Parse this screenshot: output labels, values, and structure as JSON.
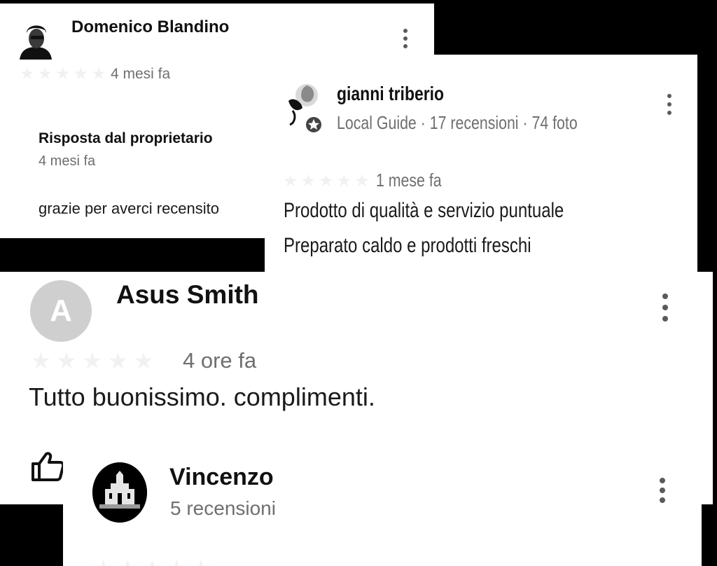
{
  "reviews": [
    {
      "name": "Domenico Blandino",
      "time": "4 mesi fa",
      "owner_reply": {
        "heading": "Risposta dal proprietario",
        "time": "4 mesi fa",
        "text": "grazie per averci recensito"
      }
    },
    {
      "name": "gianni triberio",
      "meta": "Local Guide · 17 recensioni · 74 foto",
      "time": "1 mese fa",
      "text_lines": [
        "Prodotto di qualità e servizio puntuale",
        "Preparato caldo e prodotti freschi"
      ]
    },
    {
      "name": "Asus Smith",
      "avatar_letter": "A",
      "time": "4 ore fa",
      "text": "Tutto buonissimo. complimenti."
    },
    {
      "name": "Vincenzo",
      "meta": "5 recensioni"
    }
  ],
  "icons": {
    "star": "★",
    "more": "more-vert-icon",
    "like": "thumb-up-icon"
  },
  "colors": {
    "background": "#000000",
    "card": "#ffffff",
    "muted_text": "#6f6f6f",
    "star_empty": "#f1f1f1",
    "avatar_gray": "#cfcfcf"
  }
}
